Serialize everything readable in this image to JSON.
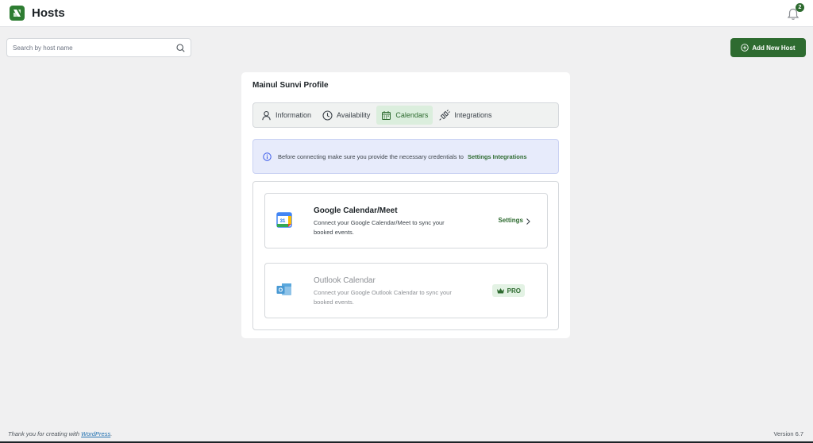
{
  "header": {
    "title": "Hosts",
    "notification_count": "2"
  },
  "search": {
    "placeholder": "Search by host name"
  },
  "actions": {
    "add_host_label": "Add New Host"
  },
  "profile": {
    "title": "Mainul Sunvi Profile"
  },
  "tabs": [
    {
      "label": "Information",
      "icon": "user-icon"
    },
    {
      "label": "Availability",
      "icon": "clock-icon"
    },
    {
      "label": "Calendars",
      "icon": "calendar-icon",
      "active": true
    },
    {
      "label": "Integrations",
      "icon": "plug-icon"
    }
  ],
  "notice": {
    "text": "Before connecting make sure you provide the necessary credentials to",
    "link": "Settings Integrations"
  },
  "calendars": [
    {
      "name": "Google Calendar/Meet",
      "description": "Connect your Google Calendar/Meet to sync your booked events.",
      "action": "Settings",
      "icon": "google-calendar-icon",
      "icon_text": "31"
    },
    {
      "name": "Outlook Calendar",
      "description": "Connect your Google Outlook Calendar to sync your booked events.",
      "badge": "PRO",
      "icon": "outlook-calendar-icon",
      "icon_text": "O"
    }
  ],
  "footer": {
    "thanks_prefix": "Thank you for creating with",
    "thanks_link": "WordPress",
    "thanks_suffix": ".",
    "version": "Version 6.7"
  },
  "colors": {
    "brand": "#2e6b30",
    "notice_bg": "#e7ebfb",
    "background": "#f0f0f1"
  }
}
